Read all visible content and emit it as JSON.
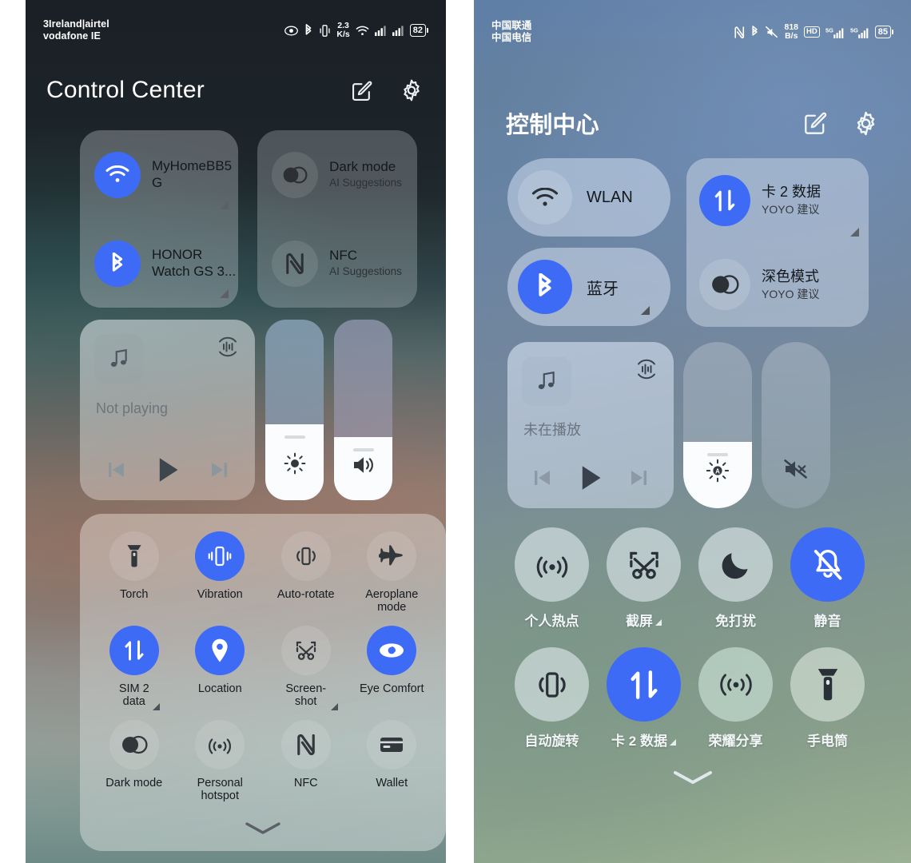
{
  "left": {
    "statusbar": {
      "carrier_line1": "3Ireland|airtel",
      "carrier_line2": "vodafone IE",
      "data_rate": "2.3",
      "data_rate_unit": "K/s",
      "battery": "82",
      "icons": [
        "eye-comfort-icon",
        "bluetooth-icon",
        "vibrate-icon",
        "data-rate",
        "wifi-icon",
        "signal-icon",
        "signal-icon",
        "battery-icon"
      ]
    },
    "header": {
      "title": "Control Center",
      "edit_icon": "edit-icon",
      "settings_icon": "gear-icon"
    },
    "connectivity": [
      {
        "id": "wifi",
        "icon": "wifi-icon",
        "title": "MyHomeBB5",
        "title2": "G",
        "sub": "",
        "on": true,
        "arrow": true
      },
      {
        "id": "bluetooth",
        "icon": "bluetooth-icon",
        "title": "HONOR",
        "title2": "Watch GS 3...",
        "sub": "",
        "on": true,
        "arrow": true
      },
      {
        "id": "dark-mode",
        "icon": "dark-mode-icon",
        "title": "Dark mode",
        "sub": "AI Suggestions",
        "on": false,
        "arrow": false
      },
      {
        "id": "nfc",
        "icon": "nfc-icon",
        "title": "NFC",
        "sub": "AI Suggestions",
        "on": false,
        "arrow": false
      }
    ],
    "media": {
      "status": "Not playing",
      "art_icon": "music-note-icon",
      "cast_icon": "cast-audio-icon",
      "prev_icon": "previous-track-icon",
      "play_icon": "play-icon",
      "next_icon": "next-track-icon"
    },
    "brightness": {
      "icon": "brightness-icon",
      "percent": 42
    },
    "volume": {
      "icon": "volume-icon",
      "percent": 35
    },
    "toggles": [
      {
        "label": "Torch",
        "icon": "torch-icon",
        "on": false,
        "arrow": false
      },
      {
        "label": "Vibration",
        "icon": "vibration-icon",
        "on": true,
        "arrow": false
      },
      {
        "label": "Auto-rotate",
        "icon": "auto-rotate-icon",
        "on": false,
        "arrow": false
      },
      {
        "label": "Aeroplane\nmode",
        "icon": "aeroplane-icon",
        "on": false,
        "arrow": false
      },
      {
        "label": "SIM 2\ndata",
        "icon": "mobile-data-icon",
        "on": true,
        "arrow": true
      },
      {
        "label": "Location",
        "icon": "location-icon",
        "on": true,
        "arrow": false
      },
      {
        "label": "Screen-\nshot",
        "icon": "screenshot-icon",
        "on": false,
        "arrow": true
      },
      {
        "label": "Eye Comfort",
        "icon": "eye-comfort-icon",
        "on": true,
        "arrow": false
      },
      {
        "label": "Dark mode",
        "icon": "dark-mode-icon",
        "on": false,
        "arrow": false
      },
      {
        "label": "Personal\nhotspot",
        "icon": "hotspot-icon",
        "on": false,
        "arrow": false
      },
      {
        "label": "NFC",
        "icon": "nfc-icon",
        "on": false,
        "arrow": false
      },
      {
        "label": "Wallet",
        "icon": "wallet-icon",
        "on": false,
        "arrow": false
      }
    ],
    "expand_icon": "chevron-down-icon"
  },
  "right": {
    "statusbar": {
      "carrier_line1": "中国联通",
      "carrier_line2": "中国电信",
      "data_rate": "818",
      "data_rate_unit": "B/s",
      "battery": "85",
      "hd_label": "HD",
      "net1": "5G",
      "net2": "5G",
      "icons": [
        "nfc-icon",
        "bluetooth-icon",
        "mute-icon",
        "data-rate",
        "hd-icon",
        "signal-5g-icon",
        "signal-5g-icon",
        "battery-icon"
      ]
    },
    "header": {
      "title": "控制中心",
      "edit_icon": "edit-icon",
      "settings_icon": "gear-icon"
    },
    "pills": [
      {
        "id": "wlan",
        "icon": "wifi-icon",
        "label": "WLAN",
        "on": false,
        "arrow": false
      },
      {
        "id": "bluetooth",
        "icon": "bluetooth-icon",
        "label": "蓝牙",
        "on": true,
        "arrow": true
      }
    ],
    "card_rows": [
      {
        "id": "sim2-data",
        "icon": "mobile-data-icon",
        "title": "卡 2 数据",
        "sub": "YOYO 建议",
        "on": true,
        "arrow": true
      },
      {
        "id": "dark-mode",
        "icon": "dark-mode-icon",
        "title": "深色模式",
        "sub": "YOYO 建议",
        "on": false,
        "arrow": false
      }
    ],
    "media": {
      "status": "未在播放",
      "art_icon": "music-note-icon",
      "cast_icon": "cast-audio-icon",
      "prev_icon": "previous-track-icon",
      "play_icon": "play-icon",
      "next_icon": "next-track-icon"
    },
    "brightness": {
      "icon": "brightness-auto-icon",
      "percent": 40
    },
    "volume": {
      "icon": "volume-mute-icon",
      "percent": 0
    },
    "toggles": [
      {
        "label": "个人热点",
        "icon": "hotspot-icon",
        "on": false,
        "arrow": false
      },
      {
        "label": "截屏",
        "icon": "screenshot-icon",
        "on": false,
        "arrow": true
      },
      {
        "label": "免打扰",
        "icon": "do-not-disturb-icon",
        "on": false,
        "arrow": false
      },
      {
        "label": "静音",
        "icon": "mute-icon",
        "on": true,
        "arrow": false
      },
      {
        "label": "自动旋转",
        "icon": "auto-rotate-icon",
        "on": false,
        "arrow": false
      },
      {
        "label": "卡 2 数据",
        "icon": "mobile-data-icon",
        "on": true,
        "arrow": true
      },
      {
        "label": "荣耀分享",
        "icon": "honor-share-icon",
        "on": false,
        "arrow": false
      },
      {
        "label": "手电筒",
        "icon": "torch-icon",
        "on": false,
        "arrow": false
      }
    ],
    "expand_icon": "chevron-down-icon"
  },
  "colors": {
    "accent": "#3d6bf5",
    "panel_text": "#14181c",
    "white": "#ffffff"
  }
}
